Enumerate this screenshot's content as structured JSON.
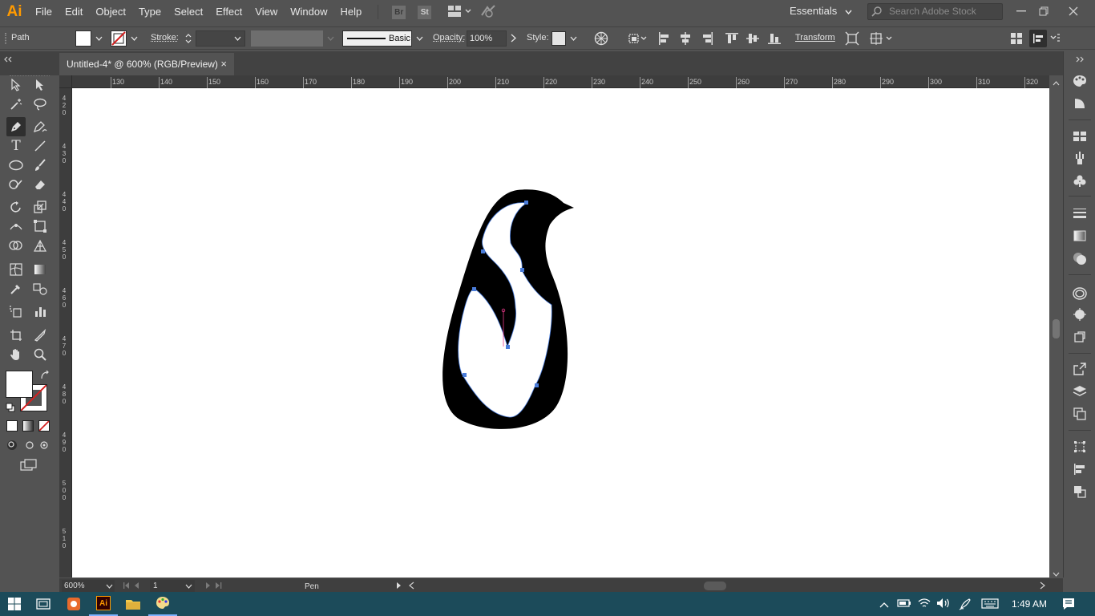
{
  "app": {
    "logo": "Ai",
    "menus": [
      "File",
      "Edit",
      "Object",
      "Type",
      "Select",
      "Effect",
      "View",
      "Window",
      "Help"
    ],
    "bridge_label": "Br",
    "stock_label": "St",
    "workspace": "Essentials",
    "search_placeholder": "Search Adobe Stock"
  },
  "control": {
    "selection_type": "Path",
    "stroke_label": "Stroke:",
    "brush_style": "Basic",
    "opacity_label": "Opacity:",
    "opacity_value": "100%",
    "style_label": "Style:",
    "transform_label": "Transform"
  },
  "document": {
    "tab_title": "Untitled-4* @ 600% (RGB/Preview)",
    "close_glyph": "×"
  },
  "ruler": {
    "horizontal": [
      "130",
      "140",
      "150",
      "160",
      "170",
      "180",
      "190",
      "200",
      "210",
      "220",
      "230",
      "240",
      "250",
      "260",
      "270",
      "280",
      "290",
      "300",
      "310",
      "320"
    ],
    "vertical": [
      "420",
      "430",
      "440",
      "450",
      "460",
      "470",
      "480",
      "490",
      "500",
      "510"
    ]
  },
  "status": {
    "zoom": "600%",
    "artboard": "1",
    "tool": "Pen"
  },
  "taskbar": {
    "time": "1:49 AM"
  },
  "colors": {
    "app_bg": "#535353",
    "accent": "#ff9a00",
    "anchor": "#4a7cd9",
    "taskbar": "#1c4b5a"
  }
}
